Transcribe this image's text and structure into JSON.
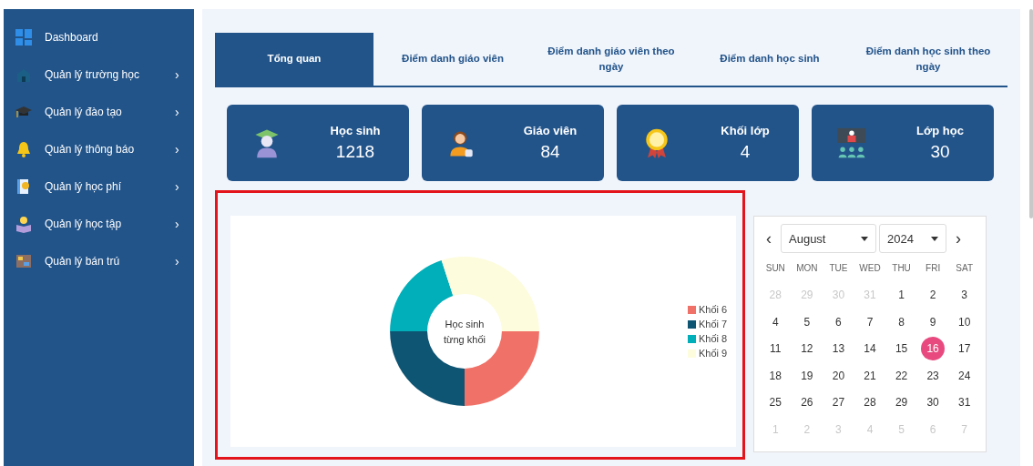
{
  "sidebar": {
    "items": [
      {
        "label": "Dashboard"
      },
      {
        "label": "Quản lý trường học",
        "arrow": "›"
      },
      {
        "label": "Quản lý đào tạo",
        "arrow": "›"
      },
      {
        "label": "Quản lý thông báo",
        "arrow": "›"
      },
      {
        "label": "Quản lý học phí",
        "arrow": "›"
      },
      {
        "label": "Quản lý học tập",
        "arrow": "›"
      },
      {
        "label": "Quản lý bán trú",
        "arrow": "›"
      }
    ]
  },
  "tabs": [
    {
      "label": "Tổng quan",
      "selected": true
    },
    {
      "label": "Điểm danh giáo viên",
      "selected": false
    },
    {
      "label": "Điểm danh giáo viên theo ngày",
      "selected": false
    },
    {
      "label": "Điểm danh học sinh",
      "selected": false
    },
    {
      "label": "Điểm danh học sinh theo ngày",
      "selected": false
    }
  ],
  "stats": [
    {
      "label": "Học sinh",
      "value": "1218"
    },
    {
      "label": "Giáo viên",
      "value": "84"
    },
    {
      "label": "Khối lớp",
      "value": "4"
    },
    {
      "label": "Lớp học",
      "value": "30"
    }
  ],
  "chart": {
    "center_label": "Học sinh từng khối",
    "legend": [
      {
        "label": "Khối 6",
        "color": "#f07167"
      },
      {
        "label": "Khối 7",
        "color": "#0e5473"
      },
      {
        "label": "Khối 8",
        "color": "#00afb9"
      },
      {
        "label": "Khối 9",
        "color": "#fdfcdc"
      }
    ]
  },
  "calendar": {
    "prev": "‹",
    "next": "›",
    "month": "August",
    "year": "2024",
    "weekdays": [
      "SUN",
      "MON",
      "TUE",
      "WED",
      "THU",
      "FRI",
      "SAT"
    ],
    "days": [
      {
        "label": "28",
        "muted": true,
        "selected": false
      },
      {
        "label": "29",
        "muted": true,
        "selected": false
      },
      {
        "label": "30",
        "muted": true,
        "selected": false
      },
      {
        "label": "31",
        "muted": true,
        "selected": false
      },
      {
        "label": "1",
        "muted": false,
        "selected": false
      },
      {
        "label": "2",
        "muted": false,
        "selected": false
      },
      {
        "label": "3",
        "muted": false,
        "selected": false
      },
      {
        "label": "4",
        "muted": false,
        "selected": false
      },
      {
        "label": "5",
        "muted": false,
        "selected": false
      },
      {
        "label": "6",
        "muted": false,
        "selected": false
      },
      {
        "label": "7",
        "muted": false,
        "selected": false
      },
      {
        "label": "8",
        "muted": false,
        "selected": false
      },
      {
        "label": "9",
        "muted": false,
        "selected": false
      },
      {
        "label": "10",
        "muted": false,
        "selected": false
      },
      {
        "label": "11",
        "muted": false,
        "selected": false
      },
      {
        "label": "12",
        "muted": false,
        "selected": false
      },
      {
        "label": "13",
        "muted": false,
        "selected": false
      },
      {
        "label": "14",
        "muted": false,
        "selected": false
      },
      {
        "label": "15",
        "muted": false,
        "selected": false
      },
      {
        "label": "16",
        "muted": false,
        "selected": true
      },
      {
        "label": "17",
        "muted": false,
        "selected": false
      },
      {
        "label": "18",
        "muted": false,
        "selected": false
      },
      {
        "label": "19",
        "muted": false,
        "selected": false
      },
      {
        "label": "20",
        "muted": false,
        "selected": false
      },
      {
        "label": "21",
        "muted": false,
        "selected": false
      },
      {
        "label": "22",
        "muted": false,
        "selected": false
      },
      {
        "label": "23",
        "muted": false,
        "selected": false
      },
      {
        "label": "24",
        "muted": false,
        "selected": false
      },
      {
        "label": "25",
        "muted": false,
        "selected": false
      },
      {
        "label": "26",
        "muted": false,
        "selected": false
      },
      {
        "label": "27",
        "muted": false,
        "selected": false
      },
      {
        "label": "28",
        "muted": false,
        "selected": false
      },
      {
        "label": "29",
        "muted": false,
        "selected": false
      },
      {
        "label": "30",
        "muted": false,
        "selected": false
      },
      {
        "label": "31",
        "muted": false,
        "selected": false
      },
      {
        "label": "1",
        "muted": true,
        "selected": false
      },
      {
        "label": "2",
        "muted": true,
        "selected": false
      },
      {
        "label": "3",
        "muted": true,
        "selected": false
      },
      {
        "label": "4",
        "muted": true,
        "selected": false
      },
      {
        "label": "5",
        "muted": true,
        "selected": false
      },
      {
        "label": "6",
        "muted": true,
        "selected": false
      },
      {
        "label": "7",
        "muted": true,
        "selected": false
      }
    ]
  }
}
